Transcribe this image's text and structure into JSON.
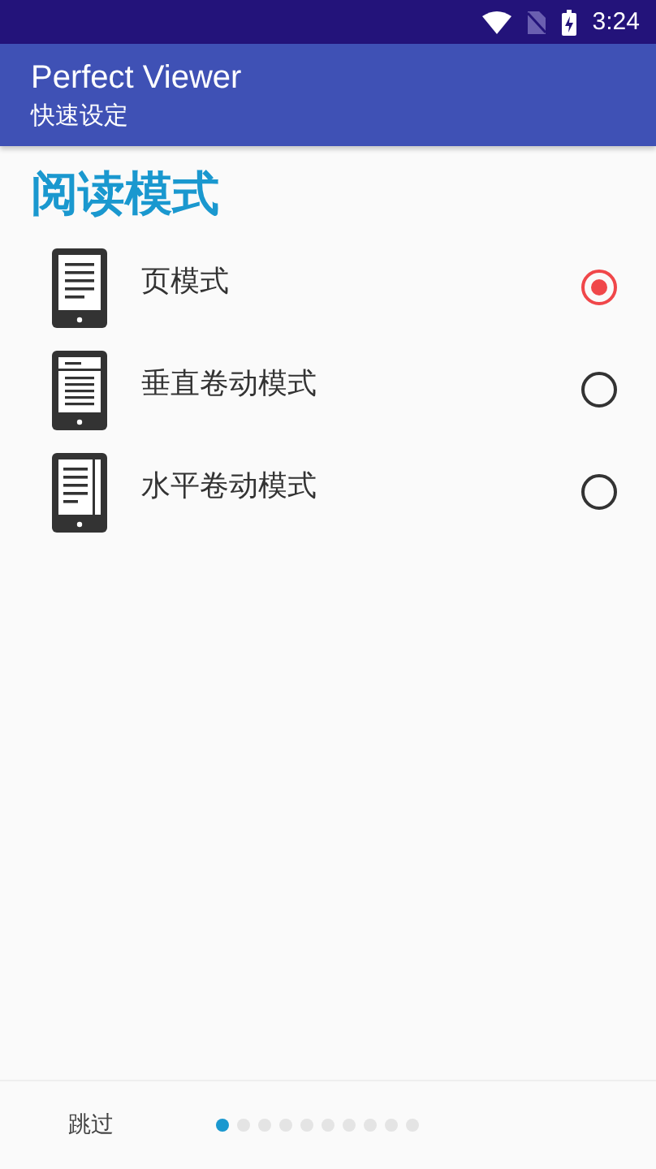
{
  "status_bar": {
    "time": "3:24"
  },
  "app_bar": {
    "title": "Perfect Viewer",
    "subtitle": "快速设定"
  },
  "section": {
    "title": "阅读模式"
  },
  "options": [
    {
      "label": "页模式",
      "kind": "page",
      "selected": true
    },
    {
      "label": "垂直卷动模式",
      "kind": "vertical",
      "selected": false
    },
    {
      "label": "水平卷动模式",
      "kind": "horizontal",
      "selected": false
    }
  ],
  "footer": {
    "skip": "跳过",
    "pages": [
      {
        "selected": true
      },
      {
        "selected": false
      },
      {
        "selected": false
      },
      {
        "selected": false
      },
      {
        "selected": false
      },
      {
        "selected": false
      },
      {
        "selected": false
      },
      {
        "selected": false
      },
      {
        "selected": false
      },
      {
        "selected": false
      }
    ]
  }
}
